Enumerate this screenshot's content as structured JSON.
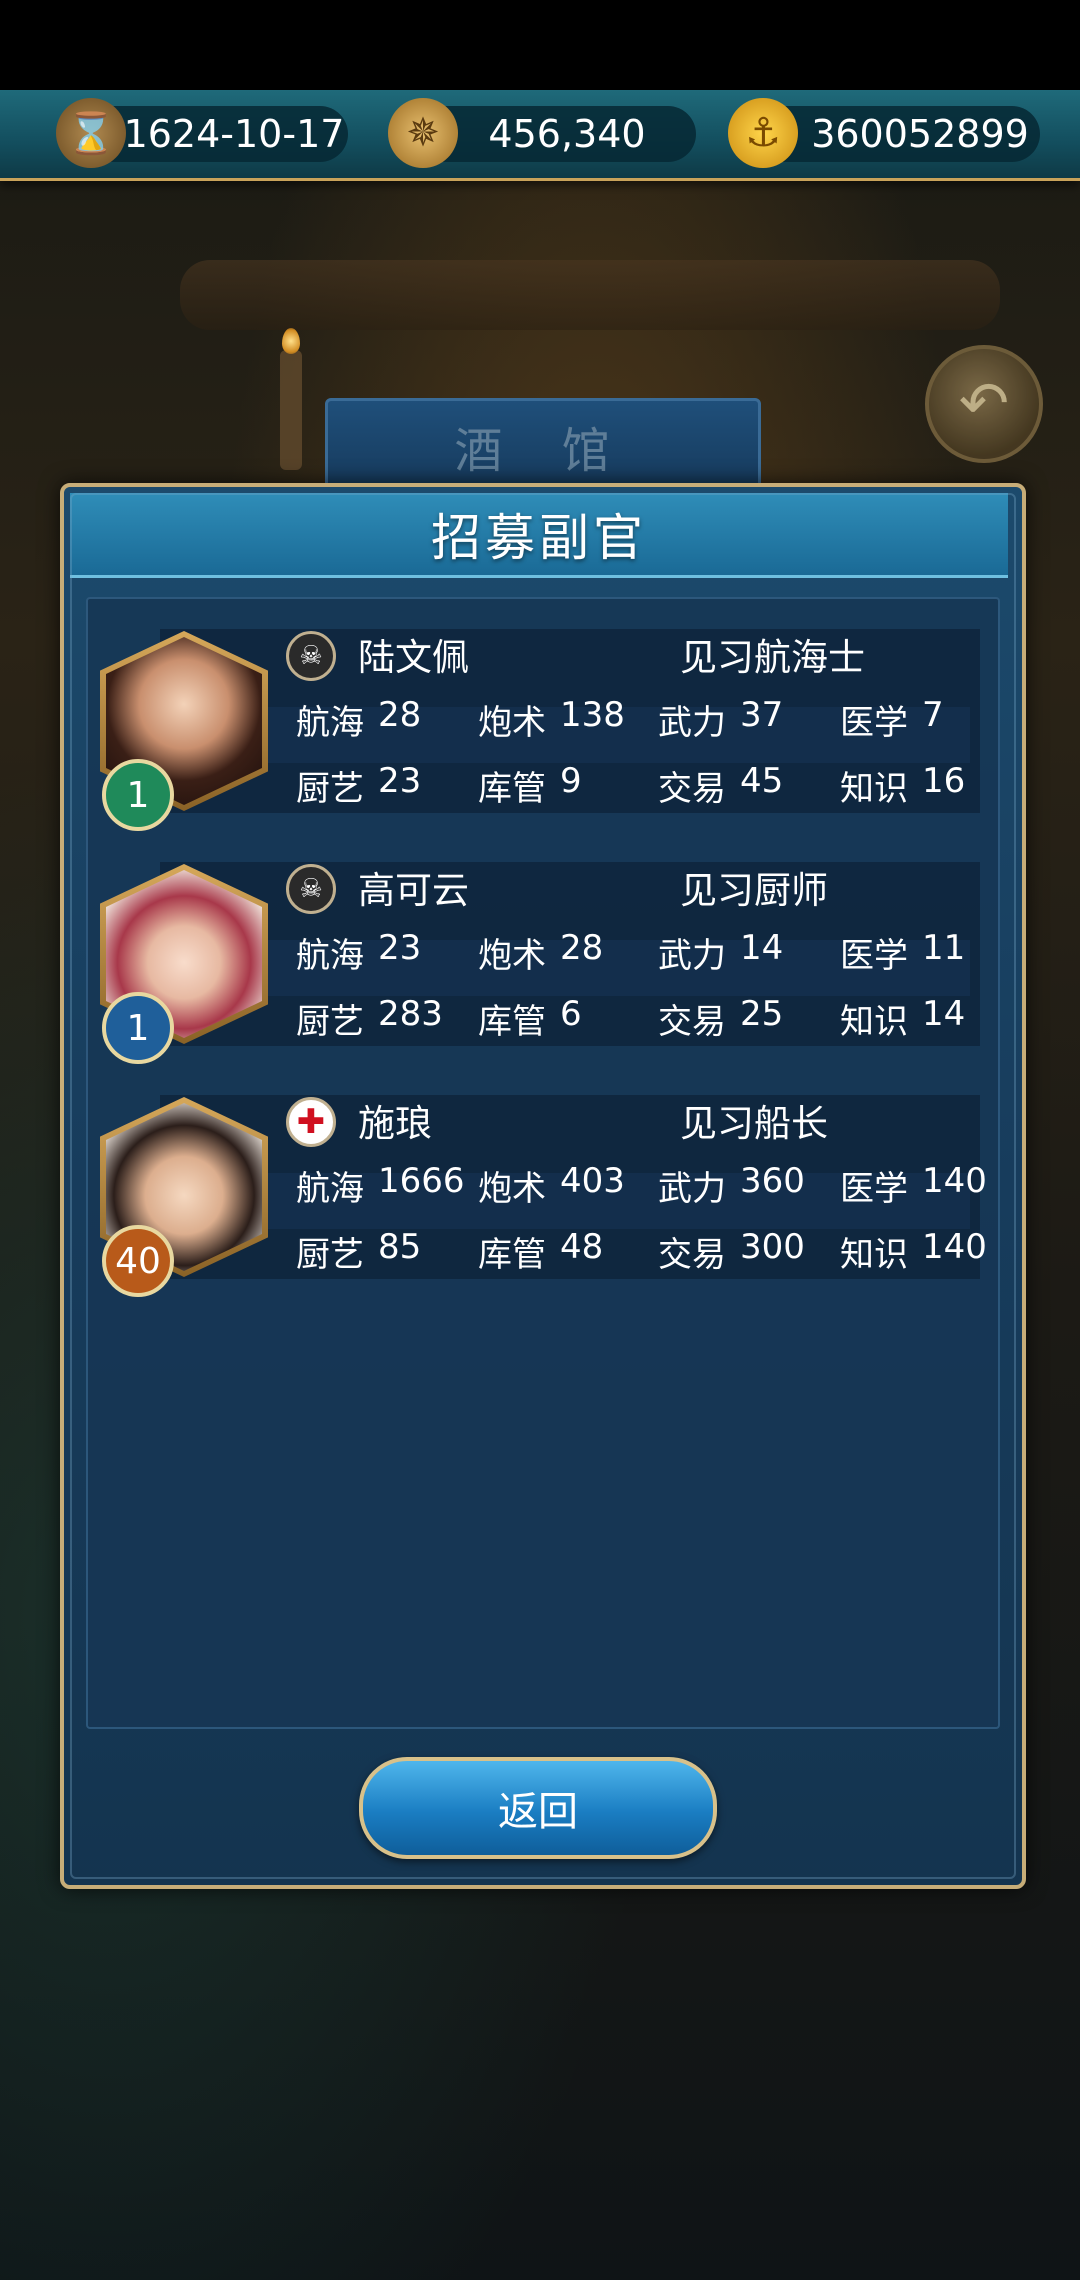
{
  "topbar": {
    "date": "1624-10-17",
    "reputation": "456,340",
    "gold": "360052899"
  },
  "background": {
    "tavern_label": "酒 馆"
  },
  "dialog": {
    "title": "招募副官",
    "back_label": "返回"
  },
  "officers": [
    {
      "name": "陆文佩",
      "role": "见习航海士",
      "level": "1",
      "flag": "pirate",
      "stats": [
        {
          "label": "航海",
          "value": "28"
        },
        {
          "label": "炮术",
          "value": "138"
        },
        {
          "label": "武力",
          "value": "37"
        },
        {
          "label": "医学",
          "value": "7"
        },
        {
          "label": "厨艺",
          "value": "23"
        },
        {
          "label": "库管",
          "value": "9"
        },
        {
          "label": "交易",
          "value": "45"
        },
        {
          "label": "知识",
          "value": "16"
        }
      ]
    },
    {
      "name": "高可云",
      "role": "见习厨师",
      "level": "1",
      "flag": "pirate",
      "stats": [
        {
          "label": "航海",
          "value": "23"
        },
        {
          "label": "炮术",
          "value": "28"
        },
        {
          "label": "武力",
          "value": "14"
        },
        {
          "label": "医学",
          "value": "11"
        },
        {
          "label": "厨艺",
          "value": "283"
        },
        {
          "label": "库管",
          "value": "6"
        },
        {
          "label": "交易",
          "value": "25"
        },
        {
          "label": "知识",
          "value": "14"
        }
      ]
    },
    {
      "name": "施琅",
      "role": "见习船长",
      "level": "40",
      "flag": "england",
      "stats": [
        {
          "label": "航海",
          "value": "1666"
        },
        {
          "label": "炮术",
          "value": "403"
        },
        {
          "label": "武力",
          "value": "360"
        },
        {
          "label": "医学",
          "value": "140"
        },
        {
          "label": "厨艺",
          "value": "85"
        },
        {
          "label": "库管",
          "value": "48"
        },
        {
          "label": "交易",
          "value": "300"
        },
        {
          "label": "知识",
          "value": "140"
        }
      ]
    }
  ]
}
